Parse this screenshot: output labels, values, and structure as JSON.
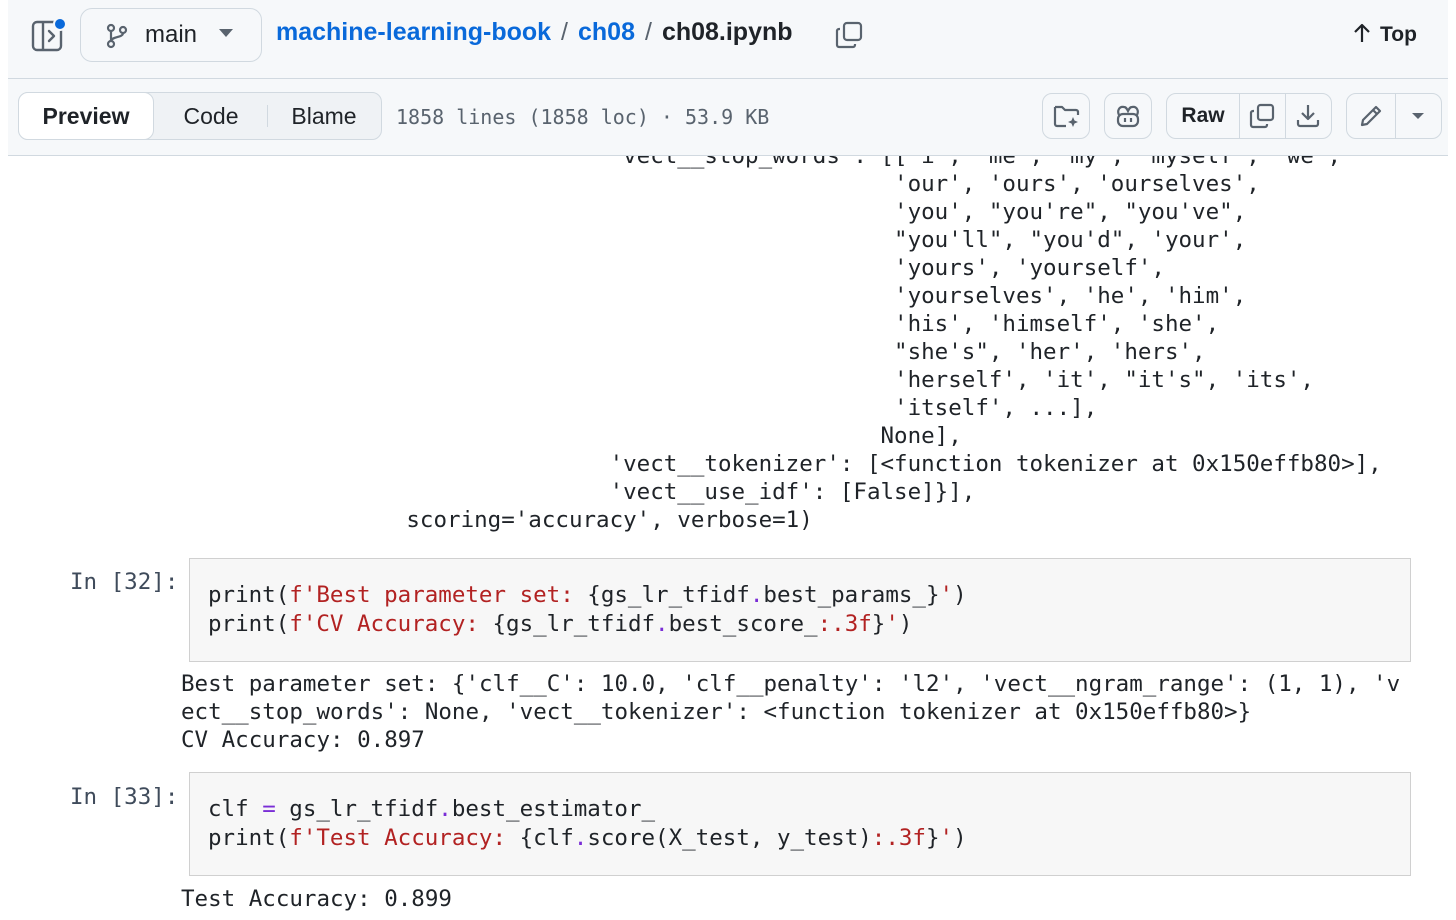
{
  "topbar": {
    "branch": "main",
    "breadcrumb": [
      {
        "label": "machine-learning-book"
      },
      {
        "label": "ch08"
      }
    ],
    "separator": "/",
    "file_name": "ch08.ipynb",
    "top_link": "Top"
  },
  "toolbar": {
    "tabs": [
      "Preview",
      "Code",
      "Blame"
    ],
    "file_info": "1858 lines (1858 loc) · 53.9 KB",
    "raw_label": "Raw"
  },
  "notebook": {
    "prev_output_lines": [
      "                                             'vect__stop_words': [['i', 'me', 'my', 'myself', 'we',",
      "                                                                  'our', 'ours', 'ourselves',",
      "                                                                  'you', \"you're\", \"you've\",",
      "                                                                  \"you'll\", \"you'd\", 'your',",
      "                                                                  'yours', 'yourself',",
      "                                                                  'yourselves', 'he', 'him',",
      "                                                                  'his', 'himself', 'she',",
      "                                                                  \"she's\", 'her', 'hers',",
      "                                                                  'herself', 'it', \"it's\", 'its',",
      "                                                                  'itself', ...],",
      "                                                                 None],",
      "                                             'vect__tokenizer': [<function tokenizer at 0x150effb80>],",
      "                                             'vect__use_idf': [False]}],",
      "                              scoring='accuracy', verbose=1)"
    ],
    "cells": [
      {
        "prompt": "In [32]:",
        "code_lines": [
          "print(f'Best parameter set: {gs_lr_tfidf.best_params_}')",
          "print(f'CV Accuracy: {gs_lr_tfidf.best_score_:.3f}')"
        ],
        "output_lines": [
          "Best parameter set: {'clf__C': 10.0, 'clf__penalty': 'l2', 'vect__ngram_range': (1, 1), 'v",
          "ect__stop_words': None, 'vect__tokenizer': <function tokenizer at 0x150effb80>}",
          "CV Accuracy: 0.897"
        ]
      },
      {
        "prompt": "In [33]:",
        "code_lines": [
          "clf = gs_lr_tfidf.best_estimator_",
          "print(f'Test Accuracy: {clf.score(X_test, y_test):.3f}')"
        ],
        "output_lines": [
          "Test Accuracy: 0.899"
        ]
      }
    ]
  },
  "icons": {
    "sidebar": "sidebar-expand-icon",
    "branch": "git-branch-icon",
    "copy_path": "copy-icon",
    "top": "arrow-up-icon",
    "add_folder": "file-directory-add-icon",
    "copilot": "copilot-icon",
    "copy_raw": "copy-icon",
    "download": "download-icon",
    "edit": "pencil-icon",
    "more": "triangle-down-icon"
  },
  "colors": {
    "link": "#0969da",
    "notification_dot": "#0969da",
    "string": "#b22222",
    "operator": "#7a2dd6"
  }
}
